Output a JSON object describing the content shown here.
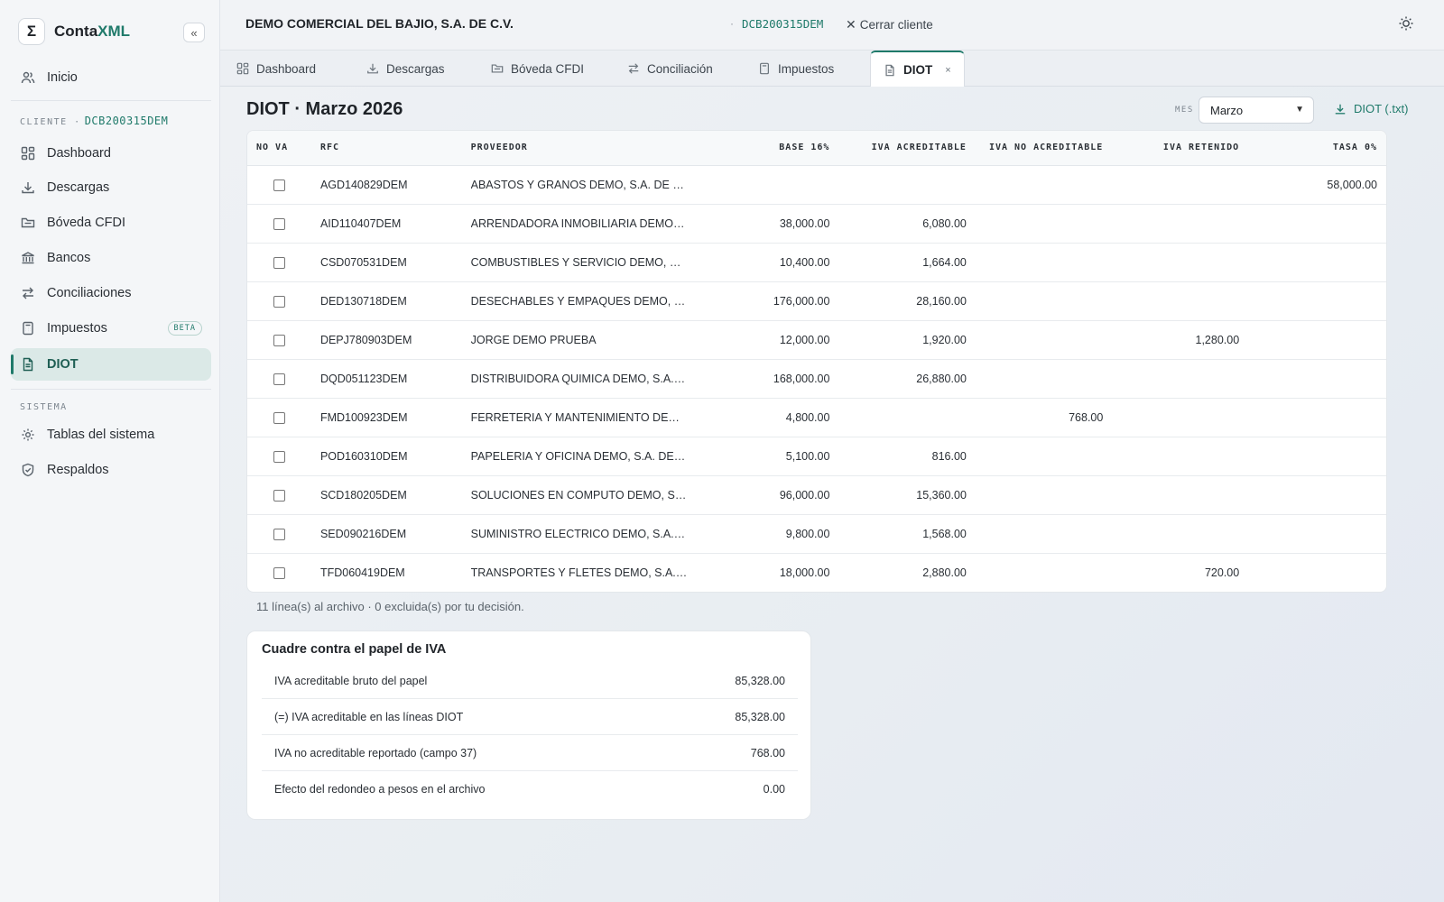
{
  "brand": {
    "logo_glyph": "Σ",
    "name_prefix": "Conta",
    "name_accent": "XML",
    "collapse_glyph": "«"
  },
  "sidebar": {
    "home": {
      "label": "Inicio",
      "icon": "users-icon"
    },
    "client_section_label": "CLIENTE ·",
    "client_rfc": "DCB200315DEM",
    "client_items": [
      {
        "label": "Dashboard",
        "icon": "dashboard-icon"
      },
      {
        "label": "Descargas",
        "icon": "download-icon"
      },
      {
        "label": "Bóveda CFDI",
        "icon": "folder-icon"
      },
      {
        "label": "Bancos",
        "icon": "bank-icon"
      },
      {
        "label": "Conciliaciones",
        "icon": "swap-icon"
      },
      {
        "label": "Impuestos",
        "icon": "calculator-icon",
        "badge": "BETA"
      },
      {
        "label": "DIOT",
        "icon": "file-icon",
        "active": true
      }
    ],
    "system_section_label": "SISTEMA",
    "system_items": [
      {
        "label": "Tablas del sistema",
        "icon": "gear-icon"
      },
      {
        "label": "Respaldos",
        "icon": "shield-icon"
      }
    ]
  },
  "topbar": {
    "company": "DEMO COMERCIAL DEL BAJIO, S.A. DE C.V.",
    "separator": "·",
    "rfc": "DCB200315DEM",
    "close_client": "Cerrar cliente",
    "theme_icon": "sun-icon"
  },
  "tabs": [
    {
      "label": "Dashboard",
      "icon": "dashboard-icon"
    },
    {
      "label": "Descargas",
      "icon": "download-icon"
    },
    {
      "label": "Bóveda CFDI",
      "icon": "folder-icon"
    },
    {
      "label": "Conciliación",
      "icon": "swap-icon"
    },
    {
      "label": "Impuestos",
      "icon": "calculator-icon"
    },
    {
      "label": "DIOT",
      "icon": "file-icon",
      "active": true,
      "close": "×"
    }
  ],
  "main": {
    "title": "DIOT · Marzo 2026",
    "month_label": "MES",
    "month_value": "Marzo",
    "export_label": "DIOT (.txt)",
    "table": {
      "headers": [
        "NO VA",
        "RFC",
        "PROVEEDOR",
        "BASE 16%",
        "IVA ACREDITABLE",
        "IVA NO ACREDITABLE",
        "IVA RETENIDO",
        "TASA 0%"
      ],
      "rows": [
        {
          "rfc": "AGD140829DEM",
          "proveedor": "ABASTOS Y GRANOS DEMO, S.A. DE C.V.",
          "base16": "",
          "iva_acred": "",
          "iva_no_acred": "",
          "iva_ret": "",
          "tasa0": "58,000.00"
        },
        {
          "rfc": "AID110407DEM",
          "proveedor": "ARRENDADORA INMOBILIARIA DEMO, S.A....",
          "base16": "38,000.00",
          "iva_acred": "6,080.00",
          "iva_no_acred": "",
          "iva_ret": "",
          "tasa0": ""
        },
        {
          "rfc": "CSD070531DEM",
          "proveedor": "COMBUSTIBLES Y SERVICIO DEMO, S.A. D...",
          "base16": "10,400.00",
          "iva_acred": "1,664.00",
          "iva_no_acred": "",
          "iva_ret": "",
          "tasa0": ""
        },
        {
          "rfc": "DED130718DEM",
          "proveedor": "DESECHABLES Y EMPAQUES DEMO, S.A. ...",
          "base16": "176,000.00",
          "iva_acred": "28,160.00",
          "iva_no_acred": "",
          "iva_ret": "",
          "tasa0": ""
        },
        {
          "rfc": "DEPJ780903DEM",
          "proveedor": "JORGE DEMO PRUEBA",
          "base16": "12,000.00",
          "iva_acred": "1,920.00",
          "iva_no_acred": "",
          "iva_ret": "1,280.00",
          "tasa0": ""
        },
        {
          "rfc": "DQD051123DEM",
          "proveedor": "DISTRIBUIDORA QUIMICA DEMO, S.A. DE ...",
          "base16": "168,000.00",
          "iva_acred": "26,880.00",
          "iva_no_acred": "",
          "iva_ret": "",
          "tasa0": ""
        },
        {
          "rfc": "FMD100923DEM",
          "proveedor": "FERRETERIA Y MANTENIMIENTO DEMO, S....",
          "base16": "4,800.00",
          "iva_acred": "",
          "iva_no_acred": "768.00",
          "iva_ret": "",
          "tasa0": ""
        },
        {
          "rfc": "POD160310DEM",
          "proveedor": "PAPELERIA Y OFICINA DEMO, S.A. DE C.V.",
          "base16": "5,100.00",
          "iva_acred": "816.00",
          "iva_no_acred": "",
          "iva_ret": "",
          "tasa0": ""
        },
        {
          "rfc": "SCD180205DEM",
          "proveedor": "SOLUCIONES EN COMPUTO DEMO, S.A. D...",
          "base16": "96,000.00",
          "iva_acred": "15,360.00",
          "iva_no_acred": "",
          "iva_ret": "",
          "tasa0": ""
        },
        {
          "rfc": "SED090216DEM",
          "proveedor": "SUMINISTRO ELECTRICO DEMO, S.A. DE C...",
          "base16": "9,800.00",
          "iva_acred": "1,568.00",
          "iva_no_acred": "",
          "iva_ret": "",
          "tasa0": ""
        },
        {
          "rfc": "TFD060419DEM",
          "proveedor": "TRANSPORTES Y FLETES DEMO, S.A. DE C...",
          "base16": "18,000.00",
          "iva_acred": "2,880.00",
          "iva_no_acred": "",
          "iva_ret": "720.00",
          "tasa0": ""
        }
      ]
    },
    "summary": "11 línea(s) al archivo · 0 excluida(s) por tu decisión.",
    "cuadre": {
      "title": "Cuadre contra el papel de IVA",
      "rows": [
        {
          "label": "IVA acreditable bruto del papel",
          "value": "85,328.00"
        },
        {
          "label": "(=) IVA acreditable en las líneas DIOT",
          "value": "85,328.00"
        },
        {
          "label": "IVA no acreditable reportado (campo 37)",
          "value": "768.00"
        },
        {
          "label": "Efecto del redondeo a pesos en el archivo",
          "value": "0.00"
        }
      ]
    }
  }
}
